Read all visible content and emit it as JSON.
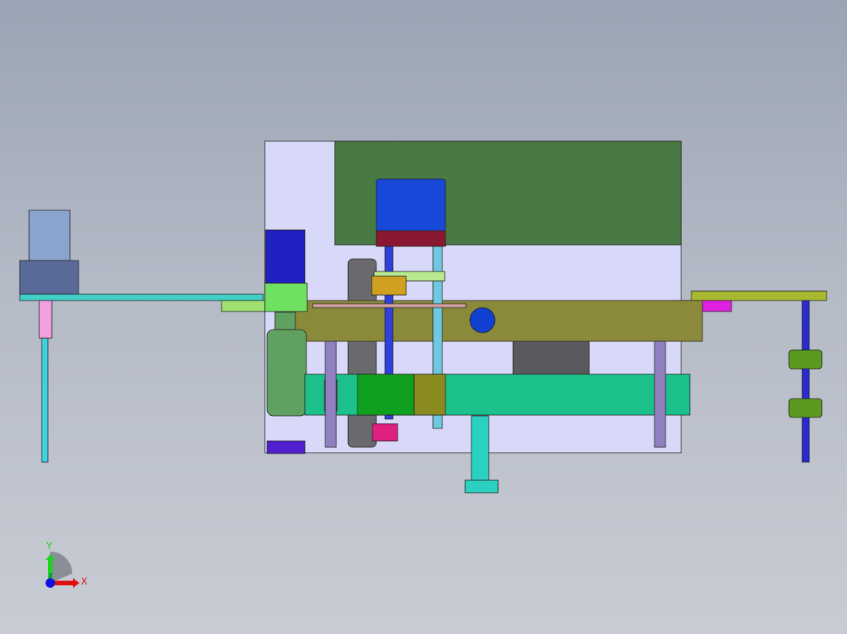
{
  "viewport": {
    "triad": {
      "x_label": "X",
      "y_label": "Y",
      "z_label": "Z"
    },
    "colors": {
      "background_top": "#9aa4b4",
      "base_plate": "#d8d8f8",
      "green_plate": "#4a7a44",
      "olive_bar": "#8a8a3a",
      "teal_bar": "#1cc08a",
      "motor_blue": "#1848d8",
      "axis_x": "#e01010",
      "axis_y": "#20d020",
      "axis_z": "#1010e0"
    }
  }
}
